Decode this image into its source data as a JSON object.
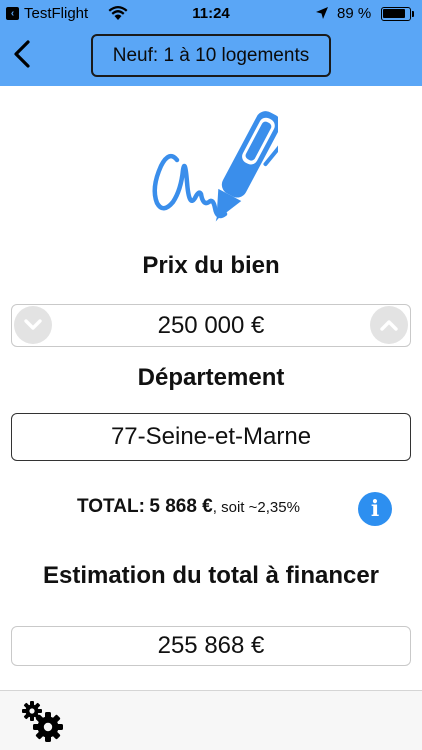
{
  "status_bar": {
    "back_app": "TestFlight",
    "time": "11:24",
    "battery_percent": "89 %",
    "battery_level": 0.89,
    "icons": [
      "back-arrow-icon",
      "wifi-icon",
      "location-arrow-icon",
      "battery-icon"
    ]
  },
  "nav": {
    "back_icon": "chevron-left-icon",
    "title": "Neuf: 1 à 10 logements"
  },
  "logo_icon": "pen-signature-icon",
  "prix": {
    "label": "Prix du bien",
    "value": "250 000 €",
    "decrement_icon": "chevron-down-circle-icon",
    "increment_icon": "chevron-up-circle-icon"
  },
  "departement": {
    "label": "Département",
    "value": "77-Seine-et-Marne"
  },
  "total": {
    "label": "TOTAL:",
    "value": "5 868 €",
    "detail": ", soit ~2,35%",
    "info_icon": "info-icon"
  },
  "estimation": {
    "label": "Estimation du total à financer",
    "value": "255 868 €"
  },
  "toolbar": {
    "settings_icon": "gears-icon"
  }
}
